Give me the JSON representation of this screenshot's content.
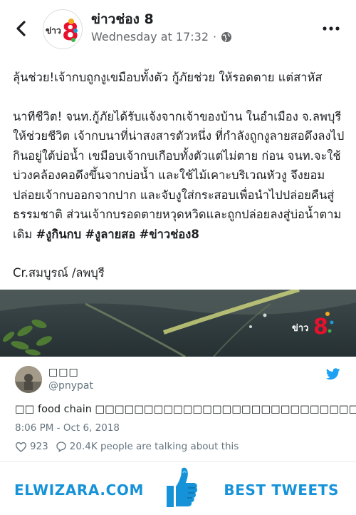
{
  "fb_post": {
    "page_name": "ข่าวช่อง 8",
    "timestamp": "Wednesday at 17:32",
    "meta_separator": "·",
    "logo_text": "ข่าว",
    "logo_digit": "8",
    "paragraph1": "ลุ้นช่วย!เจ้ากบถูกงูเขมือบทั้งตัว กู้ภัยช่วย ให้รอดตาย แต่สาหัส",
    "paragraph2_text": "นาทีชีวิต! จนท.กู้ภัยได้รับแจ้งจากเจ้าของบ้าน ในอำเมือง จ.ลพบุรี ให้ช่วยชีวิต เจ้ากบนาที่น่าสงสารตัวหนึ่ง ที่กำลังถูกงูลายสอดึงลงไปกินอยู่ใต้บ่อน้ำ เขมือบเจ้ากบเกือบทั้งตัวแต่ไม่ตาย ก่อน จนท.จะใช้บ่วงคล้องคอดึงขึ้นจากบ่อน้ำ และใช้ไม้เคาะบริเวณหัวงู จึงยอมปล่อยเจ้ากบออกจากปาก และจับงูใส่กระสอบเพื่อนำไปปล่อยคืนสู่ธรรมชาติ ส่วนเจ้ากบรอดตายหวุดหวิดและถูกปล่อยลงสู่บ่อน้ำตามเดิม",
    "hashtag1": "#งูกินกบ",
    "hashtag2": "#งูลายสอ",
    "hashtag3": "#ข่าวช่อง8",
    "credit": "Cr.สมบูรณ์ /ลพบุรี",
    "image_watermark": "ข่าว"
  },
  "tweet": {
    "display_name": "□□□",
    "handle": "@pnypat",
    "text": "□□ food chain □□□□□□□□□□□□□□□□□□□□□□□□□□□",
    "time": "8:06 PM - Oct 6, 2018",
    "likes": "923",
    "talking": "20.4K people are talking about this"
  },
  "footer": {
    "brand": "ELWIZARA.COM",
    "tagline": "BEST TWEETS"
  },
  "colors": {
    "brand_blue": "#1693d8",
    "twitter_blue": "#1da1f2",
    "muted_text": "#66757f"
  },
  "icons": {
    "back": "chevron-left-icon",
    "privacy": "globe-icon",
    "more": "more-dots-icon",
    "twitter": "twitter-bird-icon",
    "like": "heart-icon",
    "reply": "speech-bubble-icon",
    "footer": "thumbs-up-icon"
  }
}
